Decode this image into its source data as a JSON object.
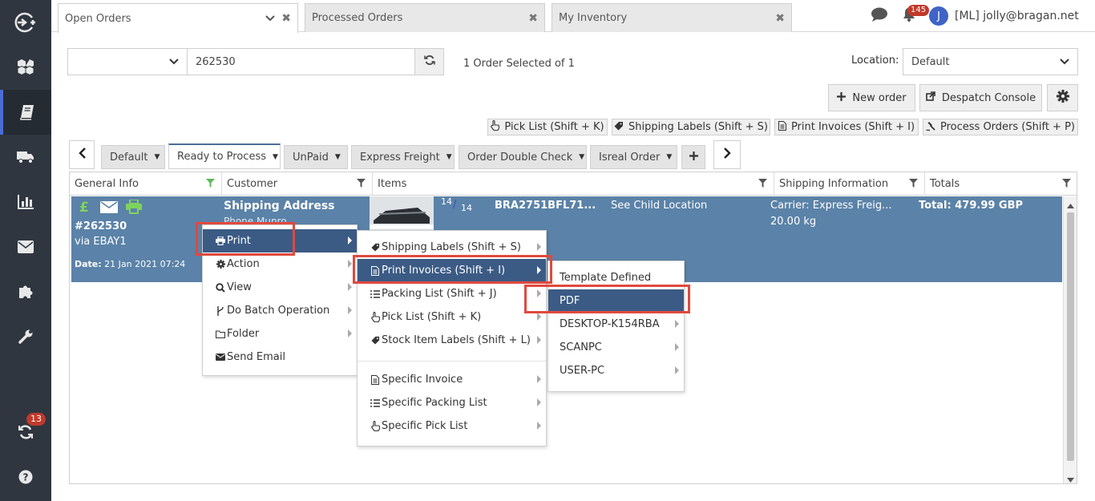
{
  "colors": {
    "sidebar": "#2f3640",
    "accent": "#3f63c7",
    "highlight": "#3b5b85",
    "selected_row": "#5b82a8",
    "annotation_red": "#e0493e",
    "badge_red": "#c0392b"
  },
  "sidebar": {
    "items": [
      {
        "icon": "add-circle-icon"
      },
      {
        "icon": "boxes-icon"
      },
      {
        "icon": "book-icon",
        "active": true
      },
      {
        "icon": "truck-icon"
      },
      {
        "icon": "bar-chart-icon"
      },
      {
        "icon": "envelope-icon"
      },
      {
        "icon": "puzzle-icon"
      },
      {
        "icon": "wrench-icon"
      }
    ],
    "sync_badge": "13",
    "help_icon": "question-icon"
  },
  "tabs": [
    {
      "label": "Open Orders",
      "active": true
    },
    {
      "label": "Processed Orders"
    },
    {
      "label": "My Inventory"
    }
  ],
  "header": {
    "notifications_badge": "145",
    "avatar_letter": "J",
    "user": "[ML] jolly@bragan.net"
  },
  "search": {
    "field_value": "",
    "query": "262530"
  },
  "selection_text": "1 Order Selected of 1",
  "location": {
    "label": "Location:",
    "value": "Default"
  },
  "actions": {
    "new_order": "New order",
    "despatch_console": "Despatch Console"
  },
  "quick_buttons": [
    "Pick List (Shift + K)",
    "Shipping Labels (Shift + S)",
    "Print Invoices (Shift + I)",
    "Process Orders (Shift + P)"
  ],
  "view_tabs": [
    "Default",
    "Ready to Process",
    "UnPaid",
    "Express Freight",
    "Order Double Check",
    "Isreal Order"
  ],
  "grid": {
    "columns": [
      "General Info",
      "Customer",
      "Items",
      "Shipping Information",
      "Totals"
    ],
    "row": {
      "order_number": "#262530",
      "source": "via EBAY1",
      "date_label": "Date:",
      "date": "21 Jan 2021 07:24",
      "customer_heading": "Shipping Address",
      "customer_name": "Phone Munro",
      "qty_top": "14",
      "qty_sep": "/",
      "qty_bottom": "14",
      "sku": "BRA2751BFL71...",
      "location": "See Child Location",
      "carrier": "Carrier: Express Freig...",
      "weight": "20.00 kg",
      "total": "Total: 479.99 GBP"
    }
  },
  "context_menu": {
    "items": [
      "Print",
      "Action",
      "View",
      "Do Batch Operation",
      "Folder",
      "Send Email"
    ]
  },
  "print_submenu": {
    "items": [
      "Shipping Labels (Shift + S)",
      "Print Invoices (Shift + I)",
      "Packing List (Shift + J)",
      "Pick List (Shift + K)",
      "Stock Item Labels (Shift + L)"
    ],
    "specific_items": [
      "Specific Invoice",
      "Specific Packing List",
      "Specific Pick List"
    ]
  },
  "invoice_submenu": {
    "items": [
      "Template Defined",
      "PDF",
      "DESKTOP-K154RBA",
      "SCANPC",
      "USER-PC"
    ]
  }
}
